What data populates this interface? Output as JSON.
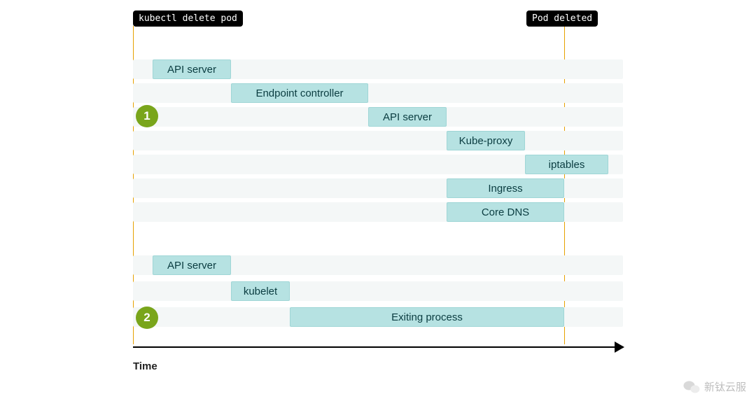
{
  "tags": {
    "start": "kubectl delete pod",
    "end": "Pod deleted"
  },
  "markers": {
    "num1": "1",
    "num2": "2"
  },
  "axis_label": "Time",
  "watermark": "新钛云服",
  "chart_data": {
    "type": "bar",
    "title": "",
    "xlabel": "Time",
    "ylabel": "",
    "x_range": [
      0,
      100
    ],
    "tracks": [
      {
        "name": "track1"
      },
      {
        "name": "track2"
      },
      {
        "name": "track3"
      },
      {
        "name": "track4"
      },
      {
        "name": "track5"
      },
      {
        "name": "track6"
      },
      {
        "name": "track7"
      },
      {
        "name": "track8"
      },
      {
        "name": "track9"
      },
      {
        "name": "track10"
      }
    ],
    "events": [
      {
        "label": "kubectl delete pod",
        "x": 0,
        "kind": "marker"
      },
      {
        "label": "Pod deleted",
        "x": 88,
        "kind": "marker"
      }
    ],
    "groups": [
      {
        "id": 1,
        "bars": [
          {
            "label": "API server",
            "track": 1,
            "start": 4,
            "end": 20
          },
          {
            "label": "Endpoint controller",
            "track": 2,
            "start": 20,
            "end": 48
          },
          {
            "label": "API server",
            "track": 3,
            "start": 48,
            "end": 64
          },
          {
            "label": "Kube-proxy",
            "track": 4,
            "start": 64,
            "end": 80
          },
          {
            "label": "iptables",
            "track": 5,
            "start": 80,
            "end": 97
          },
          {
            "label": "Ingress",
            "track": 6,
            "start": 64,
            "end": 88
          },
          {
            "label": "Core DNS",
            "track": 7,
            "start": 64,
            "end": 88
          }
        ]
      },
      {
        "id": 2,
        "bars": [
          {
            "label": "API server",
            "track": 8,
            "start": 4,
            "end": 20
          },
          {
            "label": "kubelet",
            "track": 9,
            "start": 20,
            "end": 32
          },
          {
            "label": "Exiting process",
            "track": 10,
            "start": 32,
            "end": 88
          }
        ]
      }
    ]
  }
}
